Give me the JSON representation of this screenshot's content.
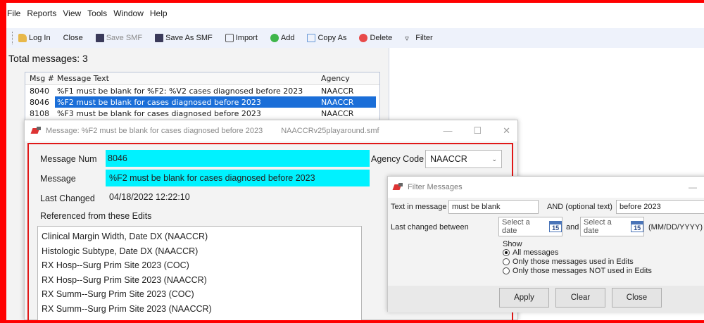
{
  "menu": [
    "File",
    "Reports",
    "View",
    "Tools",
    "Window",
    "Help"
  ],
  "toolbar": {
    "login": "Log In",
    "close": "Close",
    "save_smf": "Save SMF",
    "save_as_smf": "Save As SMF",
    "import": "Import",
    "add": "Add",
    "copy_as": "Copy As",
    "delete": "Delete",
    "filter": "Filter"
  },
  "list": {
    "total": "Total messages: 3",
    "headers": [
      "Msg #",
      "Message Text",
      "Agency"
    ],
    "rows": [
      {
        "num": "8040",
        "text": "%F1 must be blank for %F2: %V2 cases diagnosed before 2023",
        "agency": "NAACCR"
      },
      {
        "num": "8046",
        "text": "%F2 must be blank for cases diagnosed before 2023",
        "agency": "NAACCR"
      },
      {
        "num": "8108",
        "text": "%F3 must be blank for cases diagnosed before 2023",
        "agency": "NAACCR"
      }
    ]
  },
  "message_dialog": {
    "title": "Message: %F2 must be blank for cases diagnosed before 2023",
    "file": "NAACCRv25playaround.smf",
    "msg_num_label": "Message Num",
    "msg_num": "8046",
    "message_label": "Message",
    "message": "%F2 must be blank for cases diagnosed before 2023",
    "agency_label": "Agency Code",
    "agency": "NAACCR",
    "last_changed_label": "Last Changed",
    "last_changed": "04/18/2022 12:22:10",
    "referenced_label": "Referenced from these Edits",
    "edits": [
      "Clinical Margin Width, Date DX (NAACCR)",
      "Histologic Subtype, Date DX (NAACCR)",
      "RX Hosp--Surg Prim Site 2023 (COC)",
      "RX Hosp--Surg Prim Site 2023 (NAACCR)",
      "RX Summ--Surg Prim Site 2023 (COC)",
      "RX Summ--Surg Prim Site 2023 (NAACCR)"
    ]
  },
  "filter_dialog": {
    "title": "Filter Messages",
    "text_label": "Text in message",
    "text_value": "must be blank",
    "and_label": "AND (optional text)",
    "and_value": "before 2023",
    "last_changed_label": "Last changed between",
    "date_placeholder": "Select a date",
    "cal_day": "15",
    "and_word": "and",
    "date_format": "(MM/DD/YYYY)",
    "show_label": "Show",
    "options": [
      "All messages",
      "Only those messages used in Edits",
      "Only those messages NOT used in Edits"
    ],
    "apply": "Apply",
    "clear": "Clear",
    "close": "Close"
  }
}
